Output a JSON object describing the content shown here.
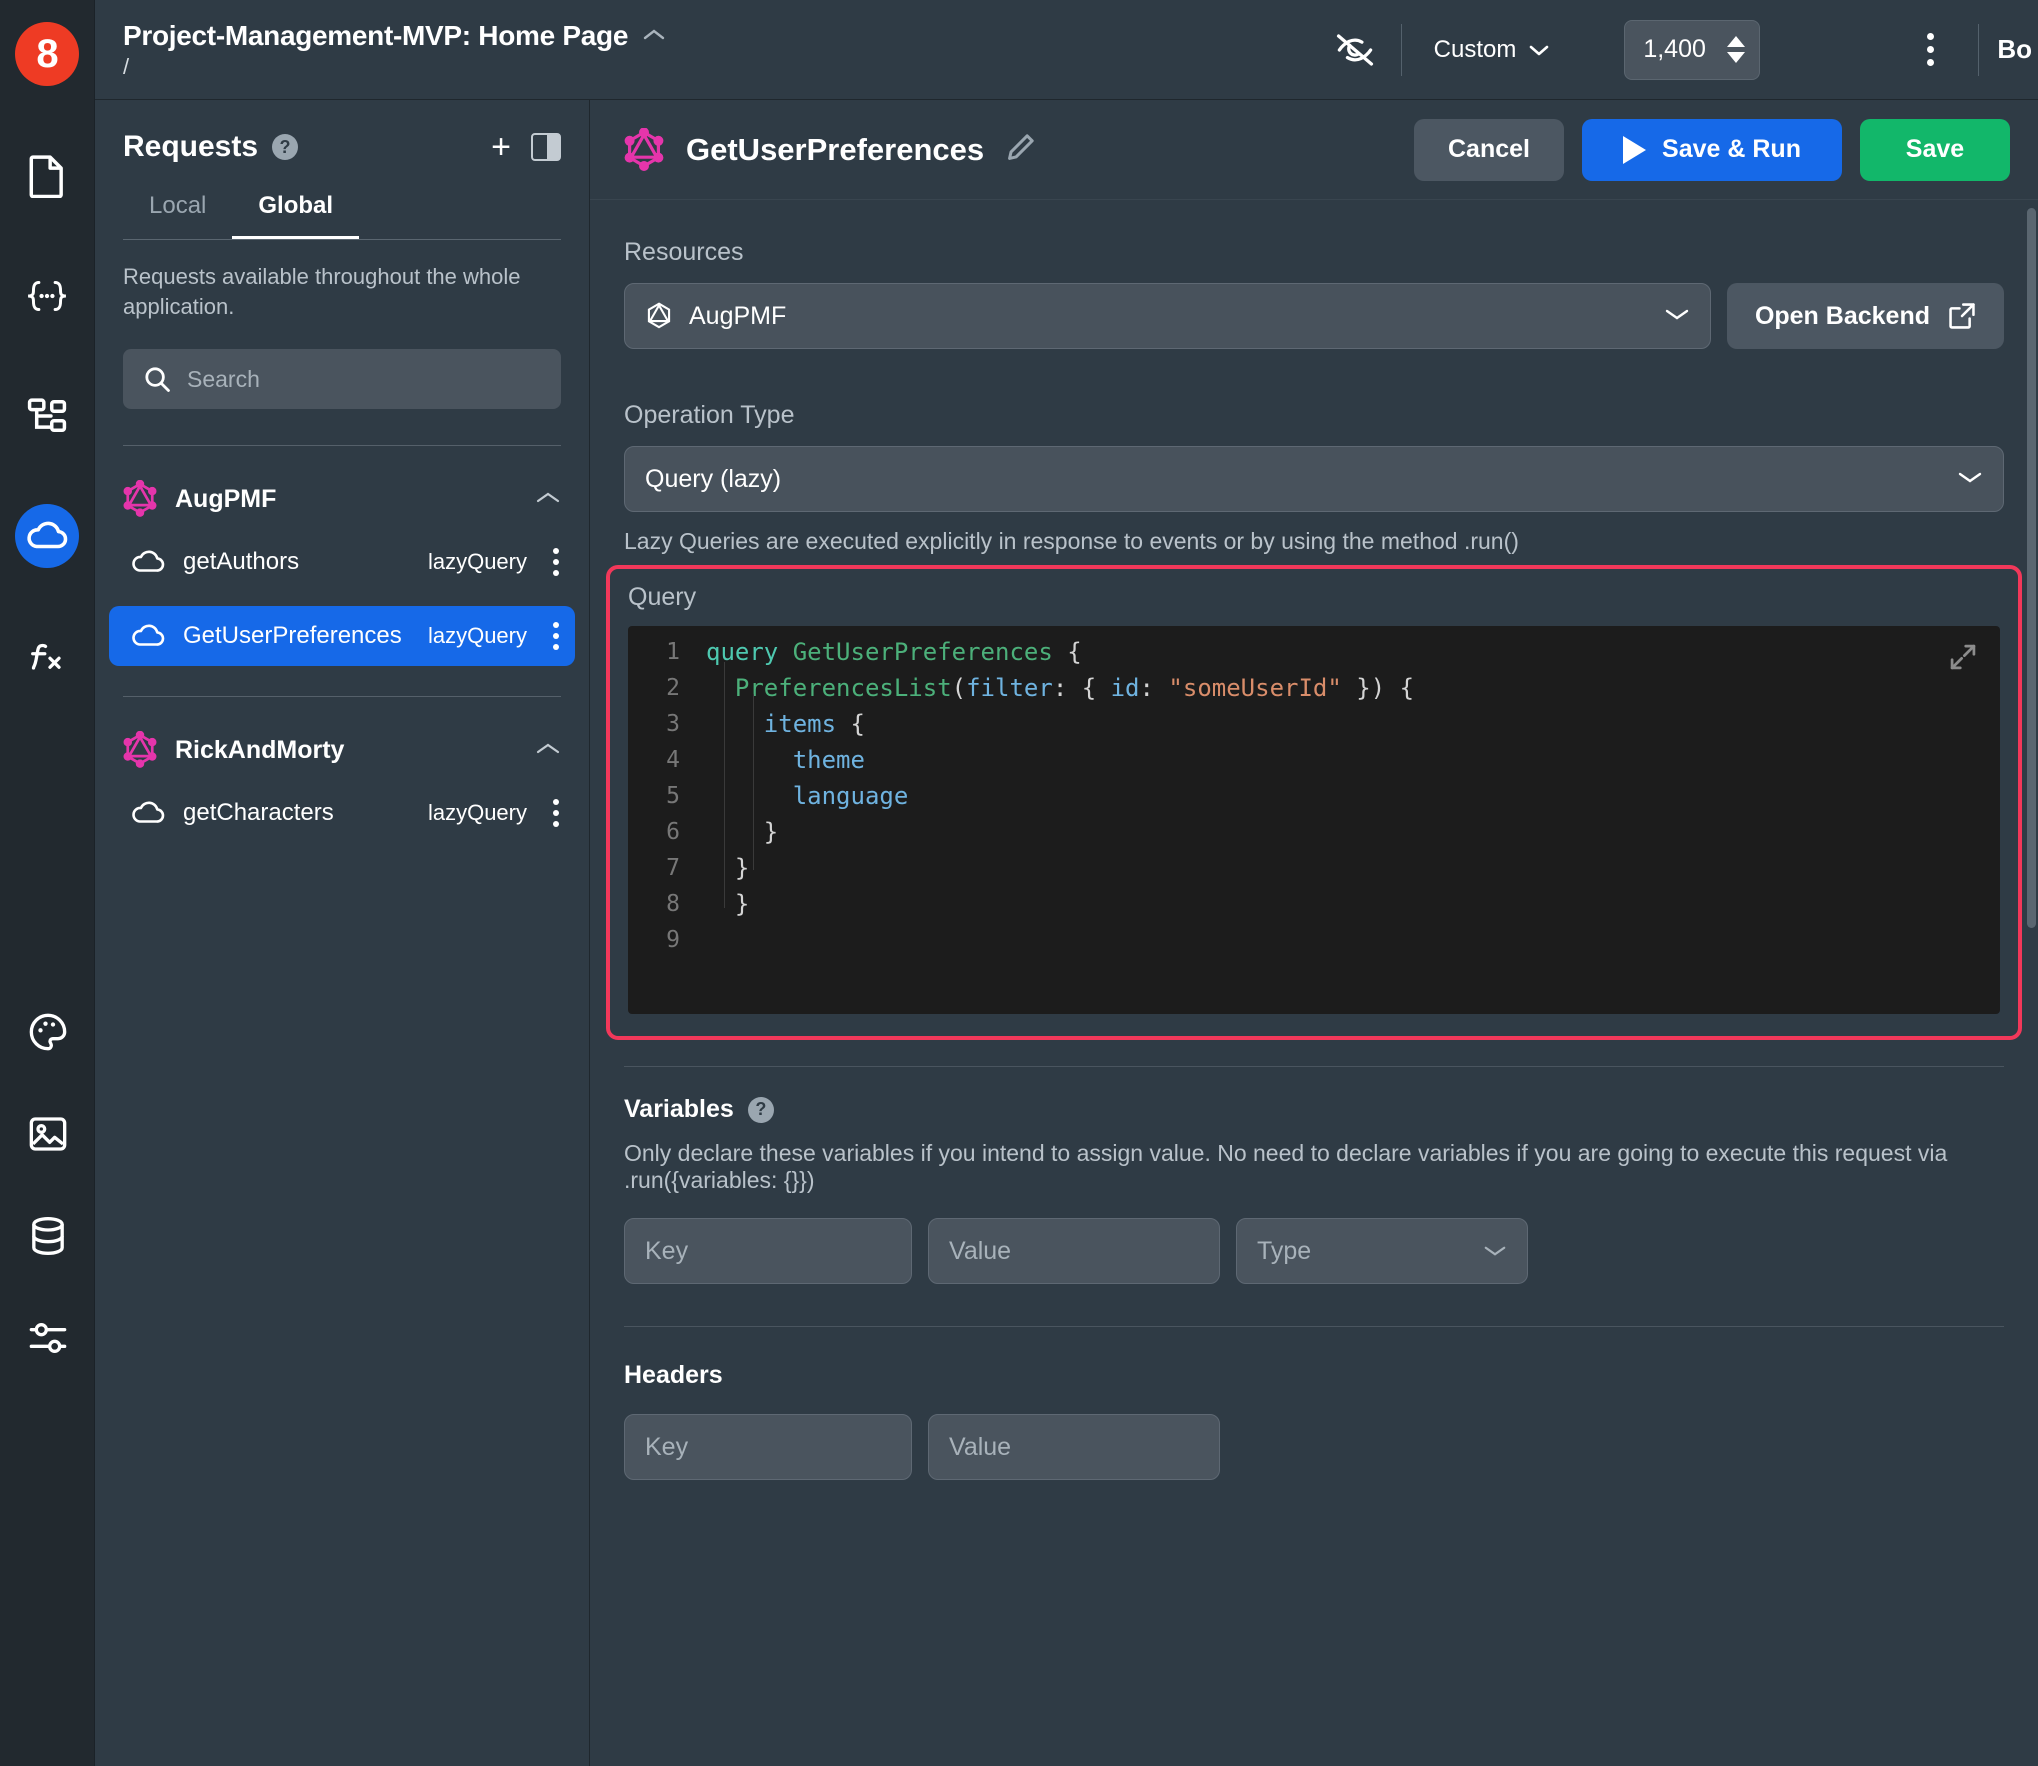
{
  "rail": {
    "logo_label": "8",
    "items": [
      {
        "name": "pages-icon",
        "label": "Pages"
      },
      {
        "name": "state-icon",
        "label": "State"
      },
      {
        "name": "components-tree-icon",
        "label": "Components"
      },
      {
        "name": "requests-cloud-icon",
        "label": "Requests",
        "active": true
      },
      {
        "name": "functions-fx-icon",
        "label": "Functions"
      }
    ],
    "bottom_items": [
      {
        "name": "theme-palette-icon",
        "label": "Theme"
      },
      {
        "name": "assets-image-icon",
        "label": "Assets"
      },
      {
        "name": "database-icon",
        "label": "Database"
      },
      {
        "name": "settings-sliders-icon",
        "label": "Settings"
      }
    ]
  },
  "topbar": {
    "title": "Project-Management-MVP: Home Page",
    "path": "/",
    "collapse_chevron": "⌃",
    "preview_toggle_icon": "eye-off-icon",
    "viewport_select": "Custom",
    "viewport_width": "1,400",
    "kebab_icon": "more-vertical-icon",
    "edge_label": "Bo"
  },
  "requests_panel": {
    "title": "Requests",
    "help_glyph": "?",
    "add_label": "+",
    "panel_toggle_name": "panel-layout-toggle",
    "tabs": [
      {
        "label": "Local",
        "active": false
      },
      {
        "label": "Global",
        "active": true
      }
    ],
    "description": "Requests available throughout the whole application.",
    "search_placeholder": "Search",
    "search_value": "",
    "groups": [
      {
        "name": "AugPMF",
        "collapsed": false,
        "chevron": "⌃",
        "items": [
          {
            "name": "getAuthors",
            "type": "lazyQuery",
            "selected": false
          },
          {
            "name": "GetUserPreferences",
            "type": "lazyQuery",
            "selected": true
          }
        ]
      },
      {
        "name": "RickAndMorty",
        "collapsed": false,
        "chevron": "⌃",
        "items": [
          {
            "name": "getCharacters",
            "type": "lazyQuery",
            "selected": false
          }
        ]
      }
    ]
  },
  "detail": {
    "title": "GetUserPreferences",
    "edit_icon": "pencil-icon",
    "cancel_label": "Cancel",
    "save_run_label": "Save & Run",
    "save_label": "Save",
    "resources_label": "Resources",
    "resource_value": "AugPMF",
    "open_backend_label": "Open Backend",
    "operation_type_label": "Operation Type",
    "operation_type_value": "Query (lazy)",
    "operation_helper": "Lazy Queries are executed explicitly in response to events or by using the method .run()",
    "query_label": "Query",
    "code_lines": [
      {
        "n": "1",
        "tokens": [
          {
            "t": "query ",
            "c": "t-kw"
          },
          {
            "t": "GetUserPreferences",
            "c": "t-name"
          },
          {
            "t": " {",
            "c": "t-punct"
          }
        ]
      },
      {
        "n": "2",
        "tokens": [
          {
            "t": "  ",
            "c": "t-punct"
          },
          {
            "t": "PreferencesList",
            "c": "t-name"
          },
          {
            "t": "(",
            "c": "t-punct"
          },
          {
            "t": "filter",
            "c": "t-field"
          },
          {
            "t": ": { ",
            "c": "t-punct"
          },
          {
            "t": "id",
            "c": "t-field"
          },
          {
            "t": ": ",
            "c": "t-punct"
          },
          {
            "t": "\"someUserId\"",
            "c": "t-str"
          },
          {
            "t": " }) {",
            "c": "t-punct"
          }
        ]
      },
      {
        "n": "3",
        "tokens": [
          {
            "t": "    ",
            "c": "t-punct"
          },
          {
            "t": "items",
            "c": "t-field"
          },
          {
            "t": " {",
            "c": "t-punct"
          }
        ]
      },
      {
        "n": "4",
        "tokens": [
          {
            "t": "      ",
            "c": "t-punct"
          },
          {
            "t": "theme",
            "c": "t-field"
          }
        ]
      },
      {
        "n": "5",
        "tokens": [
          {
            "t": "      ",
            "c": "t-punct"
          },
          {
            "t": "language",
            "c": "t-field"
          }
        ]
      },
      {
        "n": "6",
        "tokens": [
          {
            "t": "    }",
            "c": "t-punct"
          }
        ]
      },
      {
        "n": "7",
        "tokens": [
          {
            "t": "  }",
            "c": "t-punct"
          }
        ]
      },
      {
        "n": "8",
        "tokens": [
          {
            "t": "  }",
            "c": "t-punct"
          }
        ]
      },
      {
        "n": "9",
        "tokens": []
      }
    ],
    "expand_icon": "expand-diagonal-icon",
    "variables_label": "Variables",
    "variables_help_glyph": "?",
    "variables_description": "Only declare these variables if you intend to assign value. No need to declare variables if you are going to execute this request via .run({variables: {}})",
    "variables_key_placeholder": "Key",
    "variables_value_placeholder": "Value",
    "variables_type_placeholder": "Type",
    "headers_label": "Headers",
    "headers_key_placeholder": "Key",
    "headers_value_placeholder": "Value"
  },
  "colors": {
    "accent_blue": "#1669e8",
    "accent_green": "#12b76a",
    "graphql_pink": "#e535ab",
    "highlight_ring": "#f2385a",
    "logo_red": "#ee3b24",
    "panel_bg": "#2f3b45",
    "rail_bg": "#22292f",
    "editor_bg": "#1c1c1c"
  }
}
